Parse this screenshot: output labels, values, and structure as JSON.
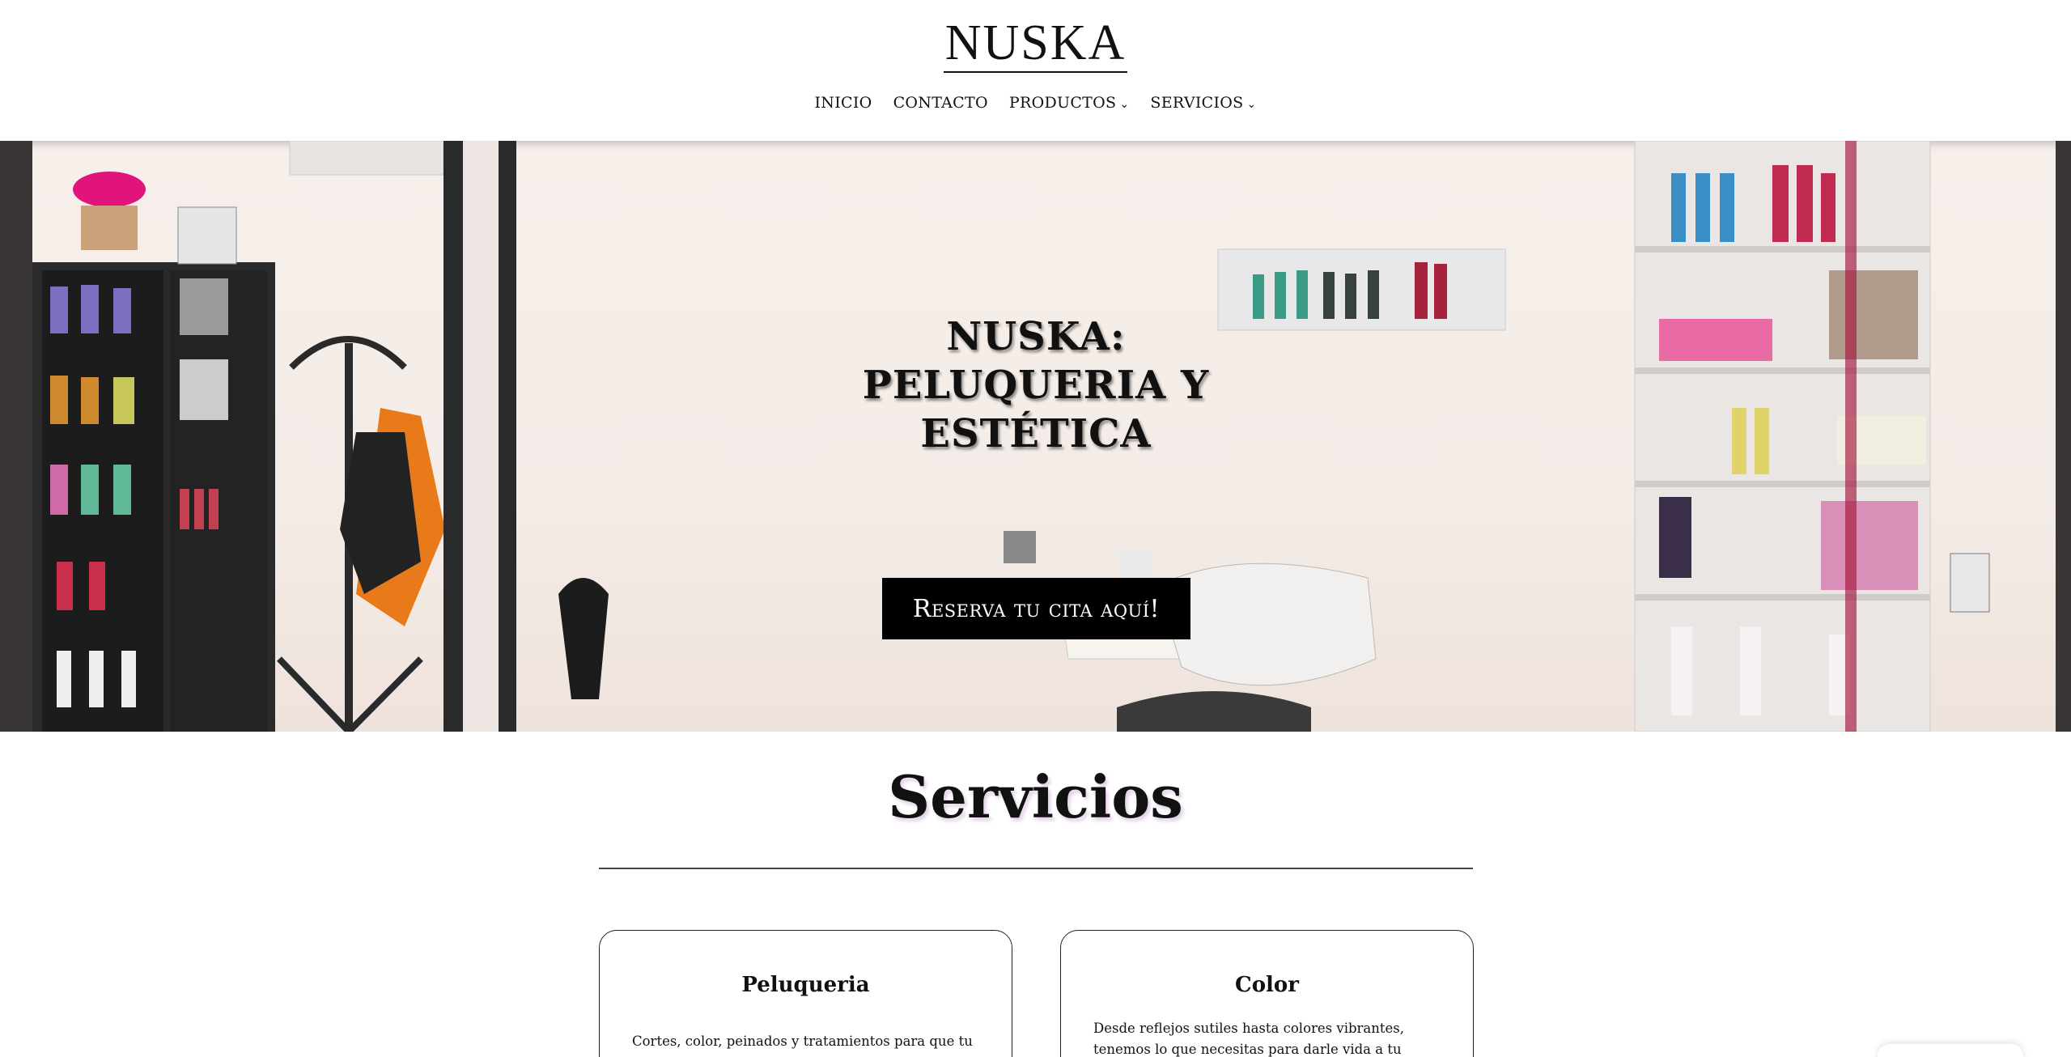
{
  "brand": {
    "logo_text": "NUSKA"
  },
  "nav": {
    "items": [
      {
        "label": "INICIO",
        "has_dropdown": false
      },
      {
        "label": "CONTACTO",
        "has_dropdown": false
      },
      {
        "label": "PRODUCTOS",
        "has_dropdown": true
      },
      {
        "label": "SERVICIOS",
        "has_dropdown": true
      }
    ],
    "caret": "⌄"
  },
  "hero": {
    "title_line1": "NUSKA: PELUQUERIA Y",
    "title_line2": "ESTÉTICA",
    "cta_label": "Reserva tu cita aquí!"
  },
  "services": {
    "heading": "Servicios",
    "cards": [
      {
        "title": "Peluqueria",
        "text": "Cortes, color, peinados y tratamientos para que tu"
      },
      {
        "title": "Color",
        "text": "Desde reflejos sutiles hasta colores vibrantes, tenemos lo que necesitas para darle vida a tu cabello."
      }
    ]
  },
  "colors": {
    "text": "#111111",
    "cta_bg": "#000000",
    "cta_text": "#ffffff",
    "card_border": "#2a1a2a",
    "hero_bg": "#f4ece7"
  }
}
